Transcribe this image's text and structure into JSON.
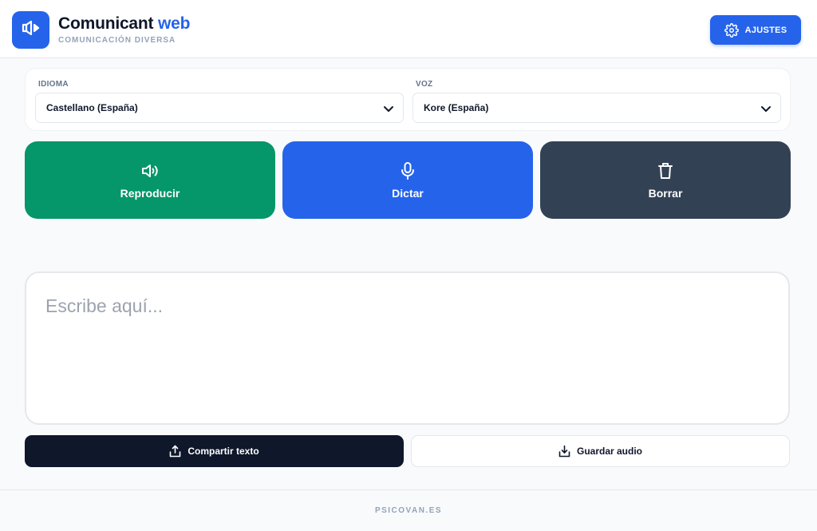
{
  "header": {
    "title_main": "Comunicant",
    "title_accent": "web",
    "subtitle": "COMUNICACIÓN DIVERSA",
    "logo_icon": "speaker-play-icon",
    "settings_label": "AJUSTES",
    "settings_icon": "gear-icon"
  },
  "selectors": {
    "language": {
      "label": "IDIOMA",
      "value": "Castellano (España)"
    },
    "voice": {
      "label": "VOZ",
      "value": "Kore (España)"
    }
  },
  "actions": [
    {
      "label": "Reproducir",
      "icon": "speaker-icon",
      "color": "#059669"
    },
    {
      "label": "Dictar",
      "icon": "microphone-icon",
      "color": "#2563eb"
    },
    {
      "label": "Borrar",
      "icon": "trash-icon",
      "color": "#334155"
    }
  ],
  "editor": {
    "placeholder": "Escribe aquí..."
  },
  "bottom": {
    "share_label": "Compartir texto",
    "save_label": "Guardar audio"
  },
  "footer": {
    "text": "PSICOVAN.ES"
  },
  "colors": {
    "accent": "#2563eb",
    "dark": "#0f172a"
  }
}
